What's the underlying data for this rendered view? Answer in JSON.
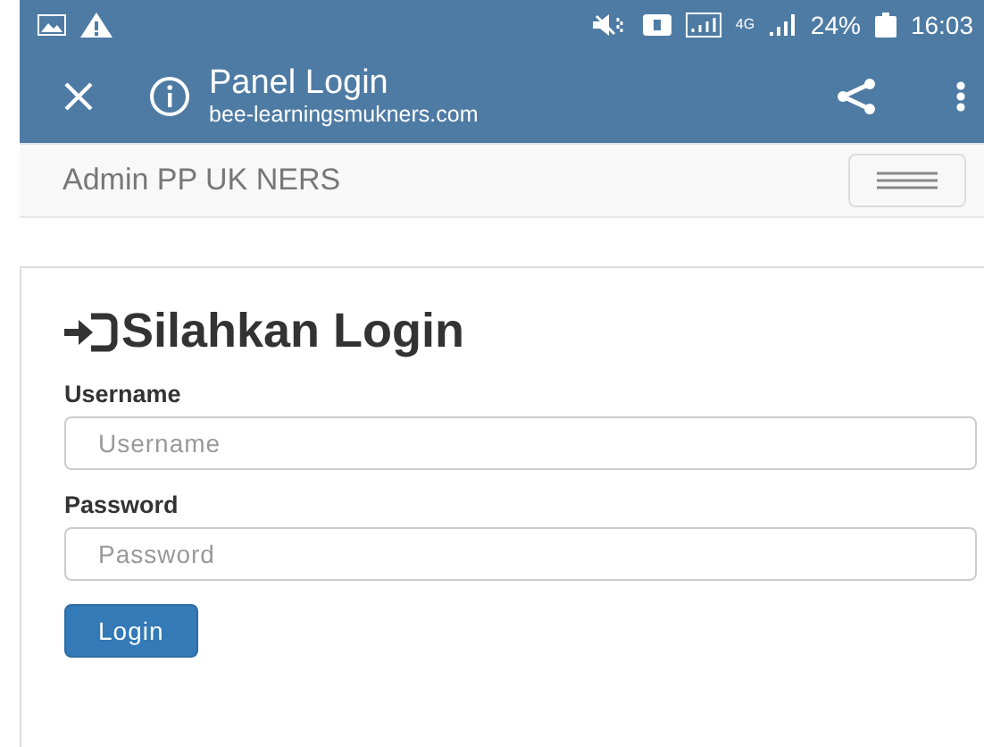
{
  "status_bar": {
    "network": "4G",
    "battery": "24%",
    "time": "16:03"
  },
  "browser_toolbar": {
    "title": "Panel Login",
    "url": "bee-learningsmukners.com"
  },
  "navbar": {
    "brand": "Admin PP UK NERS"
  },
  "login": {
    "heading": "Silahkan Login",
    "fields": [
      {
        "label": "Username",
        "placeholder": "Username"
      },
      {
        "label": "Password",
        "placeholder": "Password"
      }
    ],
    "button": "Login"
  }
}
